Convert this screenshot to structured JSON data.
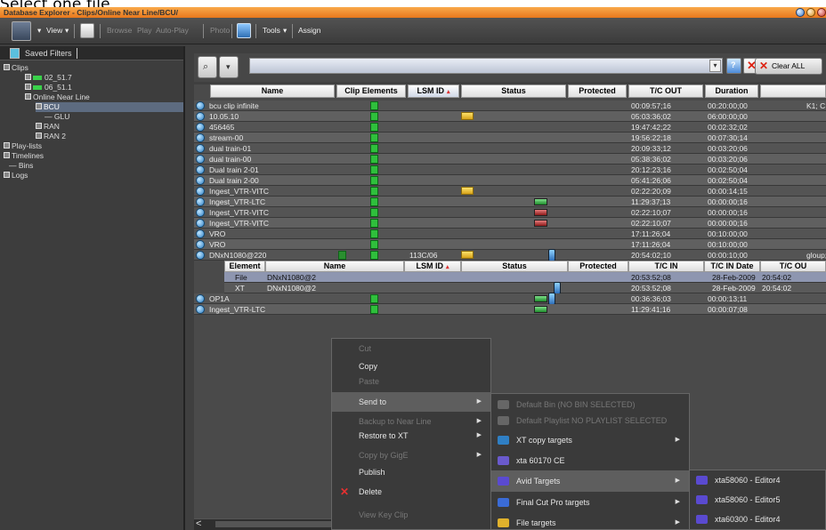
{
  "caption": "Select one file",
  "window": {
    "title": "Database Explorer - Clips/Online Near Line/BCU/"
  },
  "toolbar": {
    "view": "View",
    "browse": "Browse",
    "play": "Play",
    "autoplay": "Auto-Play",
    "photo": "Photo",
    "tools": "Tools",
    "assign": "Assign"
  },
  "left_pane": {
    "header": "Saved Filters",
    "tree": [
      {
        "label": "Clips",
        "level": 0
      },
      {
        "label": "02_51.7",
        "level": 1
      },
      {
        "label": "06_51.1",
        "level": 1
      },
      {
        "label": "Online Near Line",
        "level": 1
      },
      {
        "label": "BCU",
        "level": 2,
        "selected": true
      },
      {
        "label": "GLU",
        "level": 2
      },
      {
        "label": "RAN",
        "level": 2
      },
      {
        "label": "RAN 2",
        "level": 2
      },
      {
        "label": "Play-lists",
        "level": 0
      },
      {
        "label": "Timelines",
        "level": 0
      },
      {
        "label": "Bins",
        "level": 0
      },
      {
        "label": "Logs",
        "level": 0
      }
    ]
  },
  "filter": {
    "clear_all": "Clear ALL"
  },
  "grid": {
    "columns": [
      "Name",
      "Clip Elements",
      "LSM ID",
      "Status",
      "Protected",
      "T/C OUT",
      "Duration",
      ""
    ],
    "sort_marker": "▴",
    "rows": [
      {
        "name": "bcu clip infinite",
        "tcout": "00:09:57;16",
        "duration": "00:20:00;00",
        "extra": "K1; C"
      },
      {
        "name": "10.05.10",
        "tcout": "05:03:36;02",
        "duration": "06:00:00;00",
        "folder": true
      },
      {
        "name": "456465",
        "tcout": "19:47:42;22",
        "duration": "00:02:32;02"
      },
      {
        "name": "stream-00",
        "tcout": "19:56:22;18",
        "duration": "00:07:30;14"
      },
      {
        "name": "dual train-01",
        "tcout": "20:09:33;12",
        "duration": "00:03:20;06"
      },
      {
        "name": "dual train-00",
        "tcout": "05:38:36;02",
        "duration": "00:03:20;06"
      },
      {
        "name": "Dual train 2-01",
        "tcout": "20:12:23;16",
        "duration": "00:02:50;04"
      },
      {
        "name": "Dual train 2-00",
        "tcout": "05:41:26;06",
        "duration": "00:02:50;04"
      },
      {
        "name": "Ingest_VTR-VITC",
        "tcout": "02:22:20;09",
        "duration": "00:00:14;15",
        "folder": true
      },
      {
        "name": "Ingest_VTR-LTC",
        "tcout": "11:29:37;13",
        "duration": "00:00:00;16",
        "status": "green"
      },
      {
        "name": "Ingest_VTR-VITC",
        "tcout": "02:22:10;07",
        "duration": "00:00:00;16",
        "status": "red"
      },
      {
        "name": "Ingest_VTR-VITC",
        "tcout": "02:22:10;07",
        "duration": "00:00:00;16",
        "status": "red"
      },
      {
        "name": "VRO",
        "tcout": "17:11:26;04",
        "duration": "00:10:00;00"
      },
      {
        "name": "VRO",
        "tcout": "17:11:26;04",
        "duration": "00:10:00;00"
      },
      {
        "name": "DNxN1080@220",
        "lsmid": "113C/06",
        "tcout": "20:54:02;10",
        "duration": "00:00:10;00",
        "extra": "gloup;",
        "folder": true,
        "phone": true,
        "expanded": true
      }
    ],
    "subheader": [
      "Element",
      "Name",
      "LSM ID",
      "Status",
      "Protected",
      "T/C IN",
      "T/C IN Date",
      "T/C OU"
    ],
    "subrows": [
      {
        "element": "File",
        "name": "DNxN1080@2",
        "tcin": "20:53:52;08",
        "date": "28-Feb-2009",
        "tcout": "20:54:02",
        "selected": true
      },
      {
        "element": "XT",
        "name": "DNxN1080@2",
        "tcin": "20:53:52;08",
        "date": "28-Feb-2009",
        "tcout": "20:54:02"
      }
    ],
    "tail_rows": [
      {
        "name": "OP1A",
        "tcout": "00:36:36;03",
        "duration": "00:00:13;11",
        "status": "green",
        "phone": true
      },
      {
        "name": "Ingest_VTR-LTC",
        "tcout": "11:29:41;16",
        "duration": "00:00:07;08",
        "status": "green"
      }
    ]
  },
  "context_menu": {
    "items": [
      {
        "label": "Cut",
        "disabled": true
      },
      {
        "label": "Copy"
      },
      {
        "label": "Paste",
        "disabled": true
      },
      {
        "label": "Send to",
        "submenu": true,
        "highlighted": true
      },
      {
        "label": "Backup to Near Line",
        "disabled": true,
        "submenu": true
      },
      {
        "label": "Restore to XT",
        "submenu": true
      },
      {
        "label": "Copy by GigE",
        "disabled": true,
        "submenu": true
      },
      {
        "label": "Publish"
      },
      {
        "label": "Delete",
        "icon": "delete-icon"
      },
      {
        "label": "View Key Clip",
        "disabled": true
      }
    ]
  },
  "send_to_menu": {
    "items": [
      {
        "label": "Default Bin (NO BIN SELECTED)",
        "disabled": true
      },
      {
        "label": "Default Playlist NO PLAYLIST SELECTED",
        "disabled": true
      },
      {
        "label": "XT copy targets",
        "submenu": true
      },
      {
        "label": "xta 60170 CE"
      },
      {
        "label": "Avid Targets",
        "submenu": true,
        "highlighted": true
      },
      {
        "label": "Final Cut Pro targets",
        "submenu": true
      },
      {
        "label": "File targets",
        "submenu": true
      }
    ]
  },
  "avid_menu": {
    "items": [
      {
        "label": "xta58060 - Editor4"
      },
      {
        "label": "xta58060 - Editor5"
      },
      {
        "label": "xta60300 - Editor4"
      }
    ]
  },
  "colors": {
    "title_orange": "#e8781c",
    "selection": "#5d6b80",
    "clip_green": "#2fbf3c"
  }
}
